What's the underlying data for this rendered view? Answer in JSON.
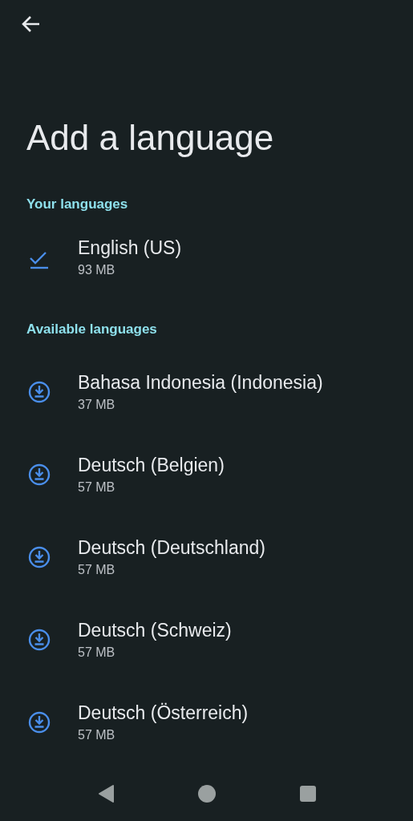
{
  "title": "Add a language",
  "sections": [
    {
      "header": "Your languages",
      "items": [
        {
          "kind": "installed",
          "name": "English (US)",
          "size": "93 MB"
        }
      ]
    },
    {
      "header": "Available languages",
      "items": [
        {
          "kind": "available",
          "name": "Bahasa Indonesia (Indonesia)",
          "size": "37 MB"
        },
        {
          "kind": "available",
          "name": "Deutsch (Belgien)",
          "size": "57 MB"
        },
        {
          "kind": "available",
          "name": "Deutsch (Deutschland)",
          "size": "57 MB"
        },
        {
          "kind": "available",
          "name": "Deutsch (Schweiz)",
          "size": "57 MB"
        },
        {
          "kind": "available",
          "name": "Deutsch (Österreich)",
          "size": "57 MB"
        }
      ]
    }
  ]
}
